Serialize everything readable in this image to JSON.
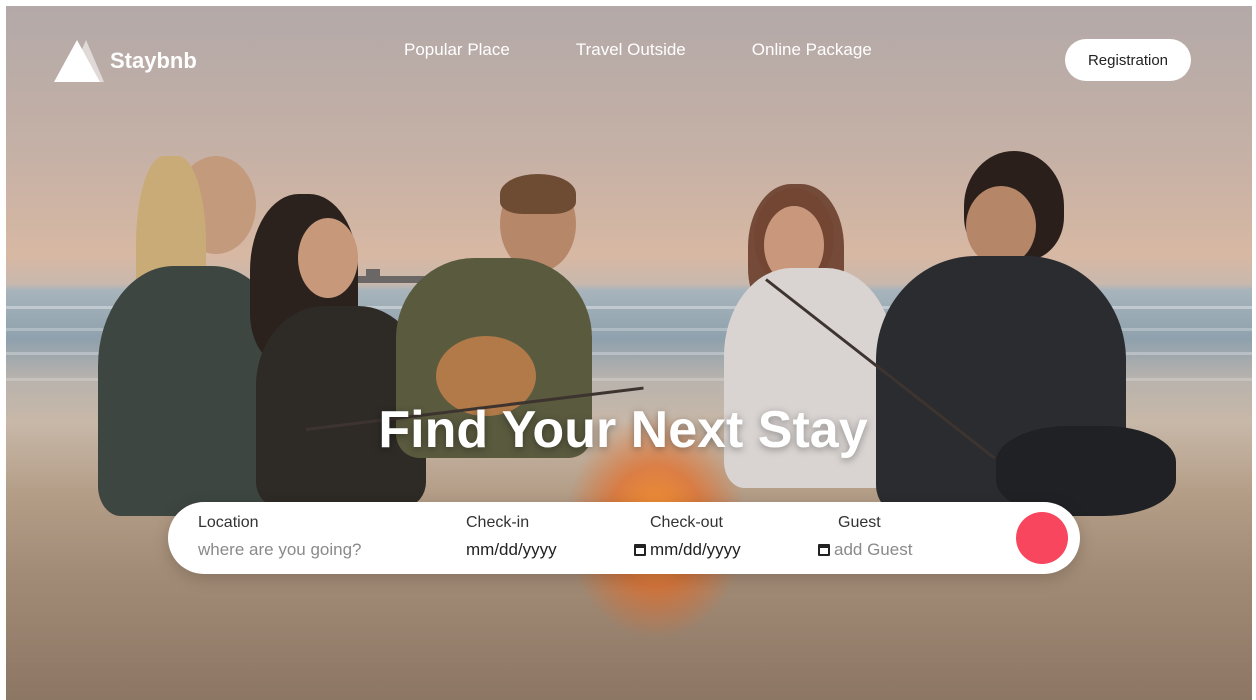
{
  "brand": {
    "name": "Staybnb"
  },
  "nav": {
    "links": [
      "Popular Place",
      "Travel Outside",
      "Online Package"
    ],
    "registration_label": "Registration"
  },
  "hero": {
    "headline": "Find Your Next Stay"
  },
  "search": {
    "location": {
      "label": "Location",
      "placeholder": "where  are you going?"
    },
    "checkin": {
      "label": "Check-in",
      "value": "mm/dd/yyyy"
    },
    "checkout": {
      "label": "Check-out",
      "value": "mm/dd/yyyy"
    },
    "guest": {
      "label": "Guest",
      "placeholder": "add Guest"
    },
    "button_color": "#f7465d"
  },
  "icons": {
    "logo": "triangle-logo-icon",
    "calendar": "calendar-icon"
  }
}
